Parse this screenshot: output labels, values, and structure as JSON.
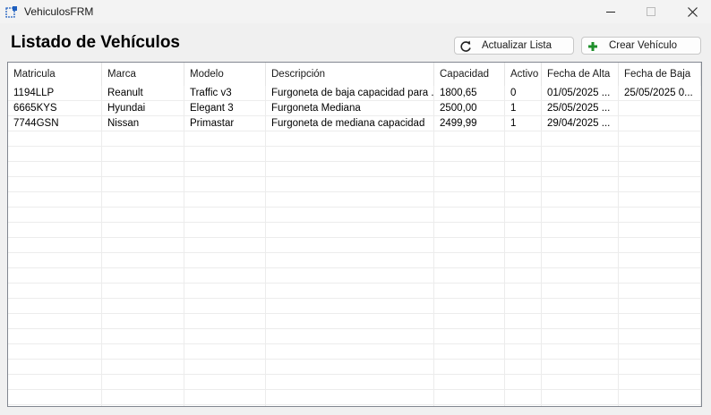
{
  "window": {
    "title": "VehiculosFRM"
  },
  "page": {
    "title": "Listado de Vehículos"
  },
  "toolbar": {
    "refresh_label": "Actualizar Lista",
    "create_label": "Crear Vehículo"
  },
  "colors": {
    "accent_green": "#1e8f2a",
    "refresh_icon": "#222222"
  },
  "table": {
    "columns": [
      "Matricula",
      "Marca",
      "Modelo",
      "Descripción",
      "Capacidad",
      "Activo",
      "Fecha de Alta",
      "Fecha de Baja"
    ],
    "rows": [
      [
        "1194LLP",
        "Reanult",
        "Traffic v3",
        "Furgoneta de baja capacidad para ...",
        "1800,65",
        "0",
        "01/05/2025 ...",
        "25/05/2025 0..."
      ],
      [
        "6665KYS",
        "Hyundai",
        "Elegant 3",
        "Furgoneta Mediana",
        "2500,00",
        "1",
        "25/05/2025 ...",
        ""
      ],
      [
        "7744GSN",
        "Nissan",
        "Primastar",
        "Furgoneta de mediana capacidad",
        "2499,99",
        "1",
        "29/04/2025 ...",
        ""
      ]
    ]
  }
}
